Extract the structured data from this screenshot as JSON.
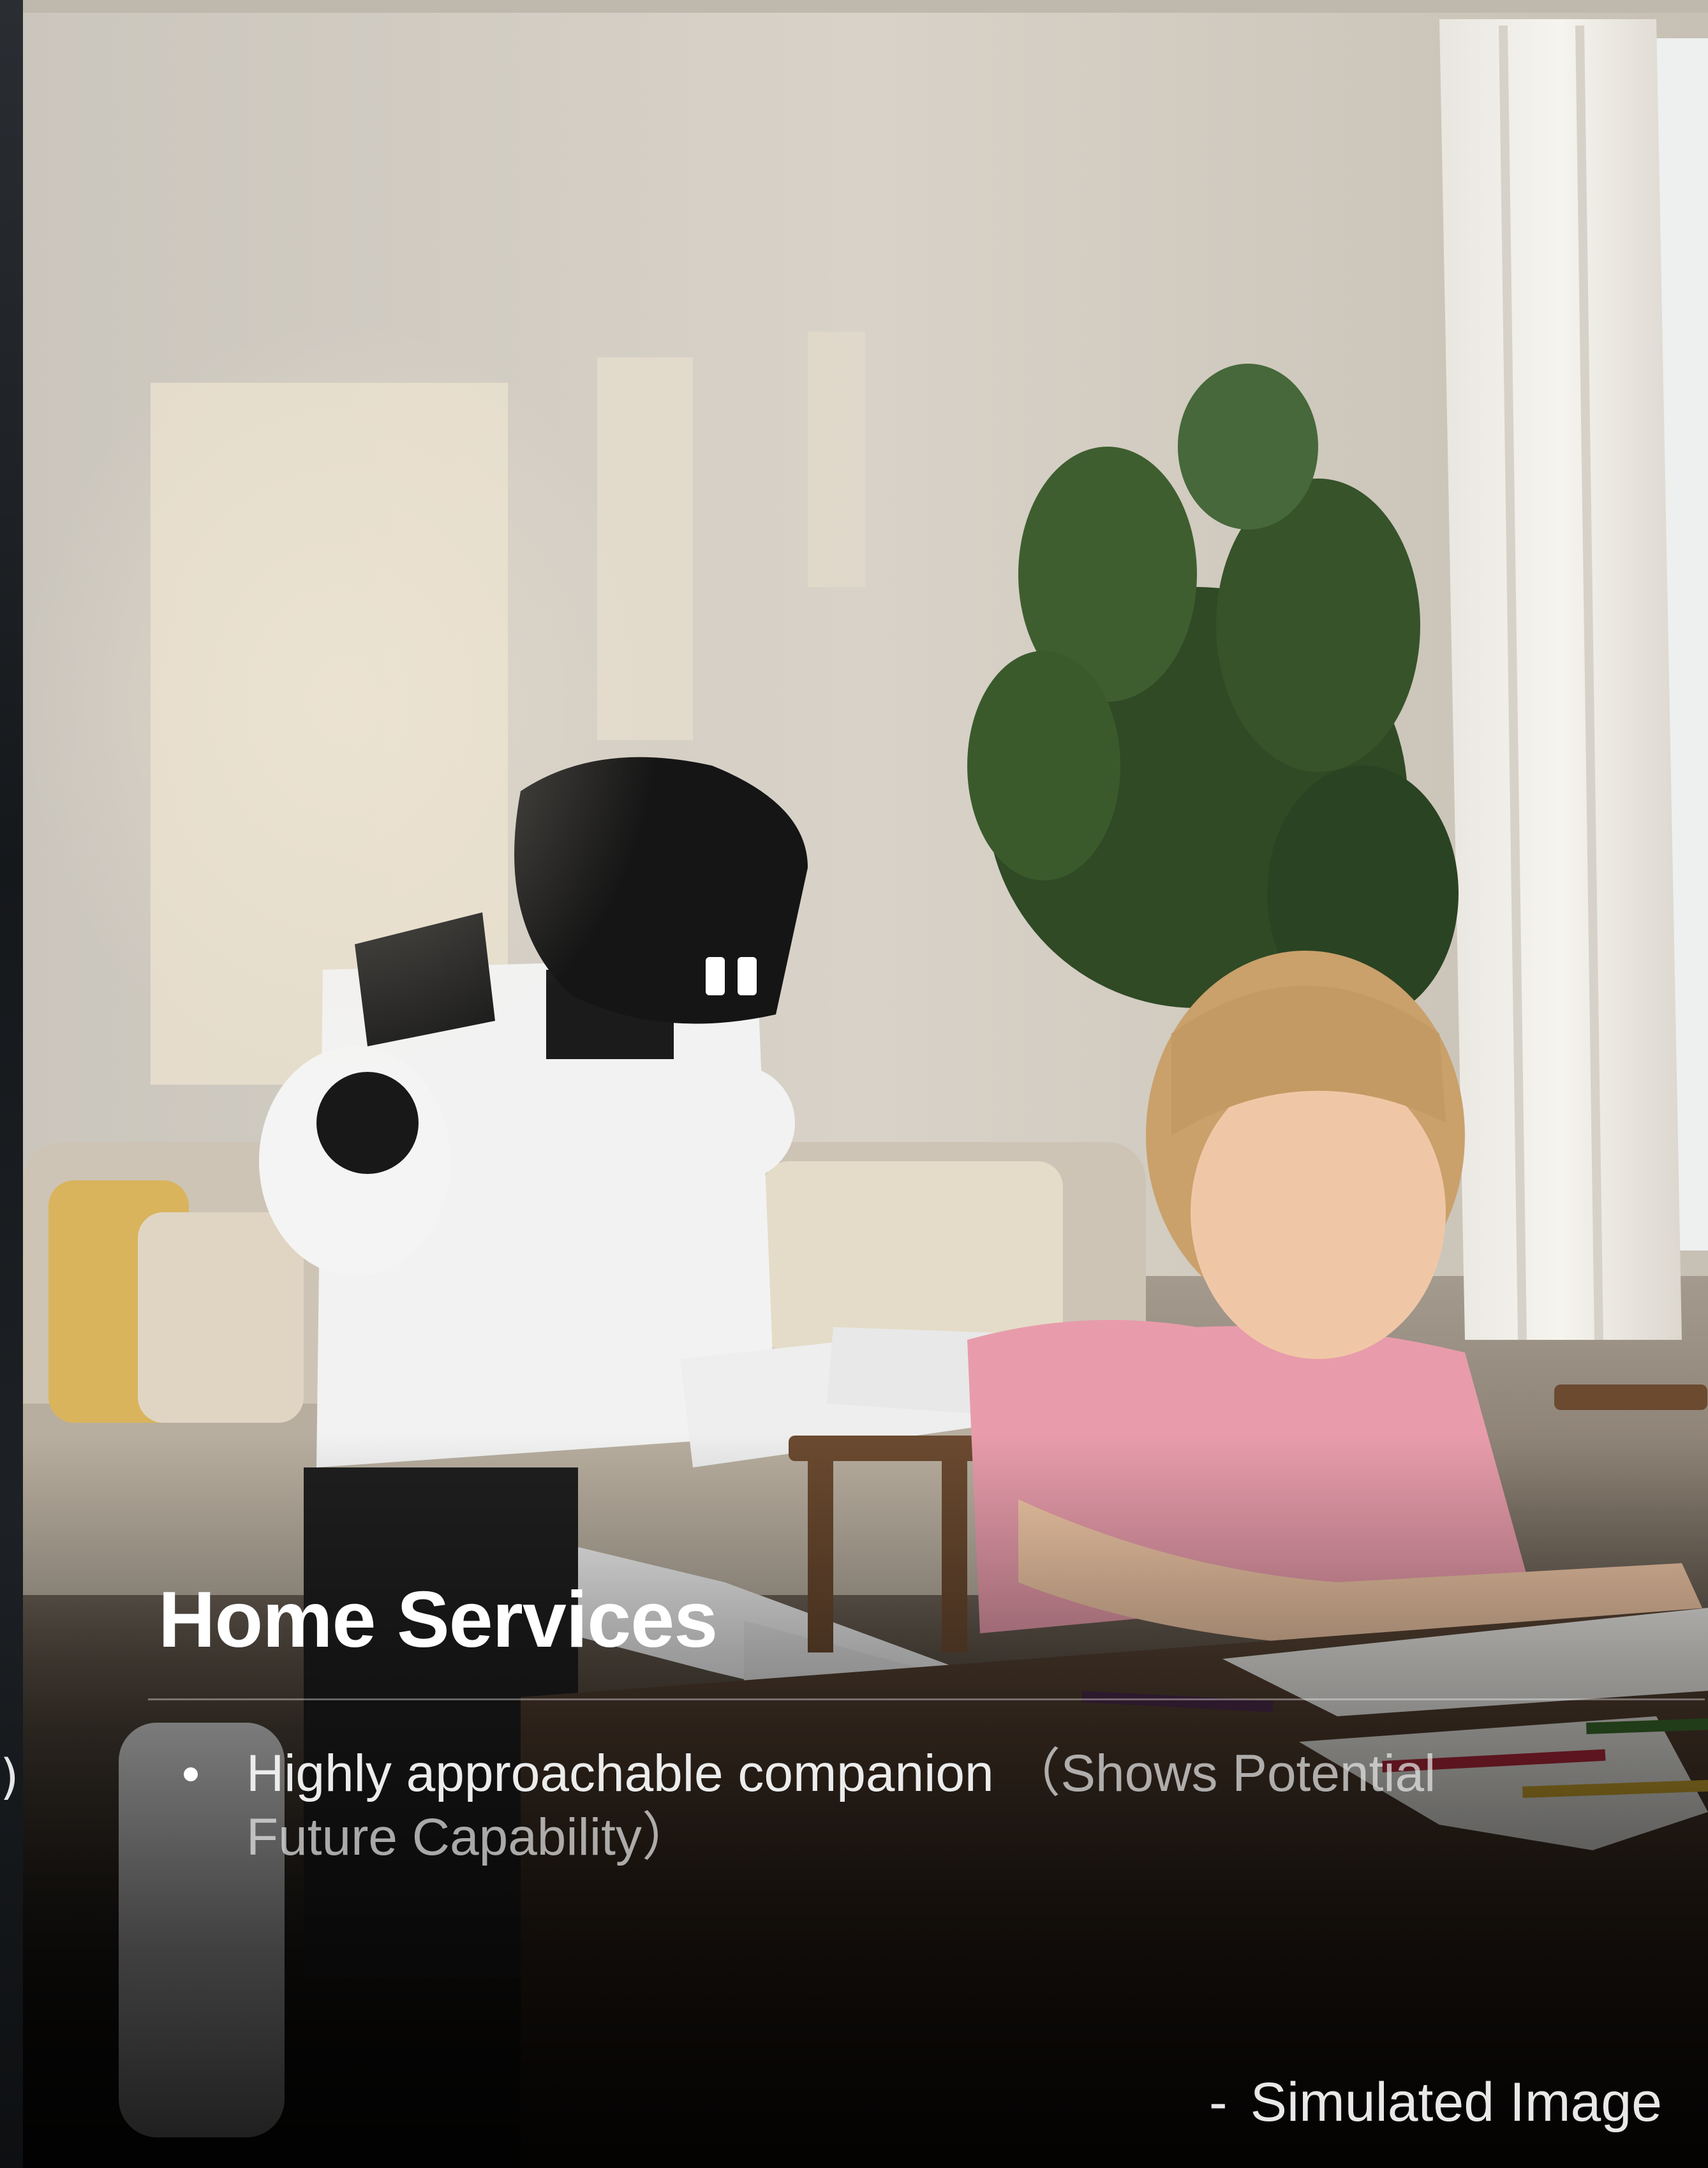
{
  "slide": {
    "title": "Home Services",
    "bullets": [
      {
        "text": "Highly approachable companion",
        "note": "（Shows Potential Future Capability）"
      }
    ],
    "caption_dash": "-",
    "caption": "Simulated Image"
  },
  "previous_slide": {
    "edge_glyph": ")"
  },
  "photo": {
    "alt_subjects": [
      "humanoid-robot",
      "girl-drawing",
      "potted-plant",
      "sofa",
      "wooden-table",
      "window-curtain"
    ]
  },
  "colors": {
    "title": "#ffffff",
    "text": "#ececec",
    "robot_body": "#f2f2f2",
    "robot_head": "#151515",
    "shirt": "#e79aa8",
    "plant": "#2f4a25"
  }
}
